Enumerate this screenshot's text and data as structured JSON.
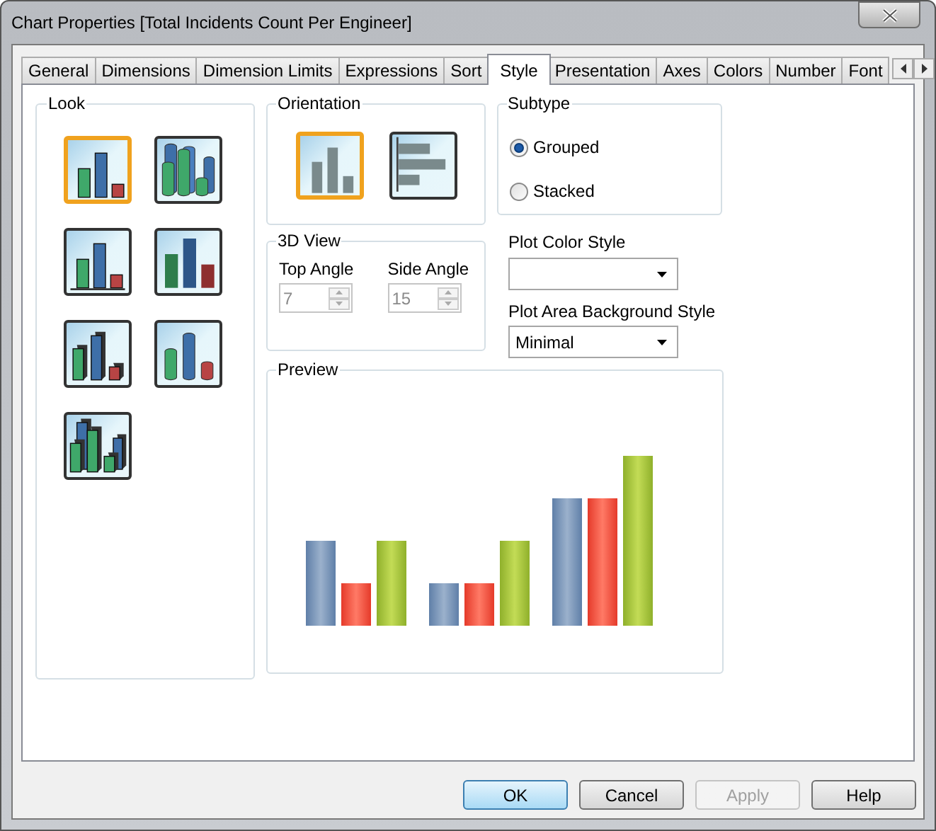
{
  "window": {
    "title": "Chart Properties [Total Incidents Count Per Engineer]"
  },
  "tabs": [
    {
      "label": "General",
      "selected": false
    },
    {
      "label": "Dimensions",
      "selected": false
    },
    {
      "label": "Dimension Limits",
      "selected": false
    },
    {
      "label": "Expressions",
      "selected": false
    },
    {
      "label": "Sort",
      "selected": false
    },
    {
      "label": "Style",
      "selected": true
    },
    {
      "label": "Presentation",
      "selected": false
    },
    {
      "label": "Axes",
      "selected": false
    },
    {
      "label": "Colors",
      "selected": false
    },
    {
      "label": "Number",
      "selected": false
    },
    {
      "label": "Font",
      "selected": false
    }
  ],
  "look": {
    "label": "Look",
    "options": [
      {
        "kind": "flat",
        "selected": true
      },
      {
        "kind": "cylinders-deep",
        "selected": false
      },
      {
        "kind": "shadow",
        "selected": false
      },
      {
        "kind": "soft",
        "selected": false
      },
      {
        "kind": "boxes",
        "selected": false
      },
      {
        "kind": "cylinders",
        "selected": false
      },
      {
        "kind": "boxes-deep",
        "selected": false
      }
    ]
  },
  "orientation": {
    "label": "Orientation",
    "options": [
      {
        "kind": "vertical",
        "selected": true
      },
      {
        "kind": "horizontal",
        "selected": false
      }
    ]
  },
  "subtype": {
    "label": "Subtype",
    "options": [
      {
        "label": "Grouped",
        "selected": true
      },
      {
        "label": "Stacked",
        "selected": false
      }
    ]
  },
  "view_3d": {
    "label": "3D View",
    "fields": [
      {
        "label": "Top Angle",
        "value": "7",
        "disabled": true
      },
      {
        "label": "Side Angle",
        "value": "15",
        "disabled": true
      }
    ]
  },
  "plot_color_style": {
    "label": "Plot Color Style"
  },
  "plot_area_background_style": {
    "label": "Plot Area Background Style",
    "value": "Minimal"
  },
  "preview": {
    "label": "Preview"
  },
  "buttons": [
    {
      "label": "OK",
      "default": true,
      "disabled": false
    },
    {
      "label": "Cancel",
      "default": false,
      "disabled": false
    },
    {
      "label": "Apply",
      "default": false,
      "disabled": true
    },
    {
      "label": "Help",
      "default": false,
      "disabled": false
    }
  ]
}
